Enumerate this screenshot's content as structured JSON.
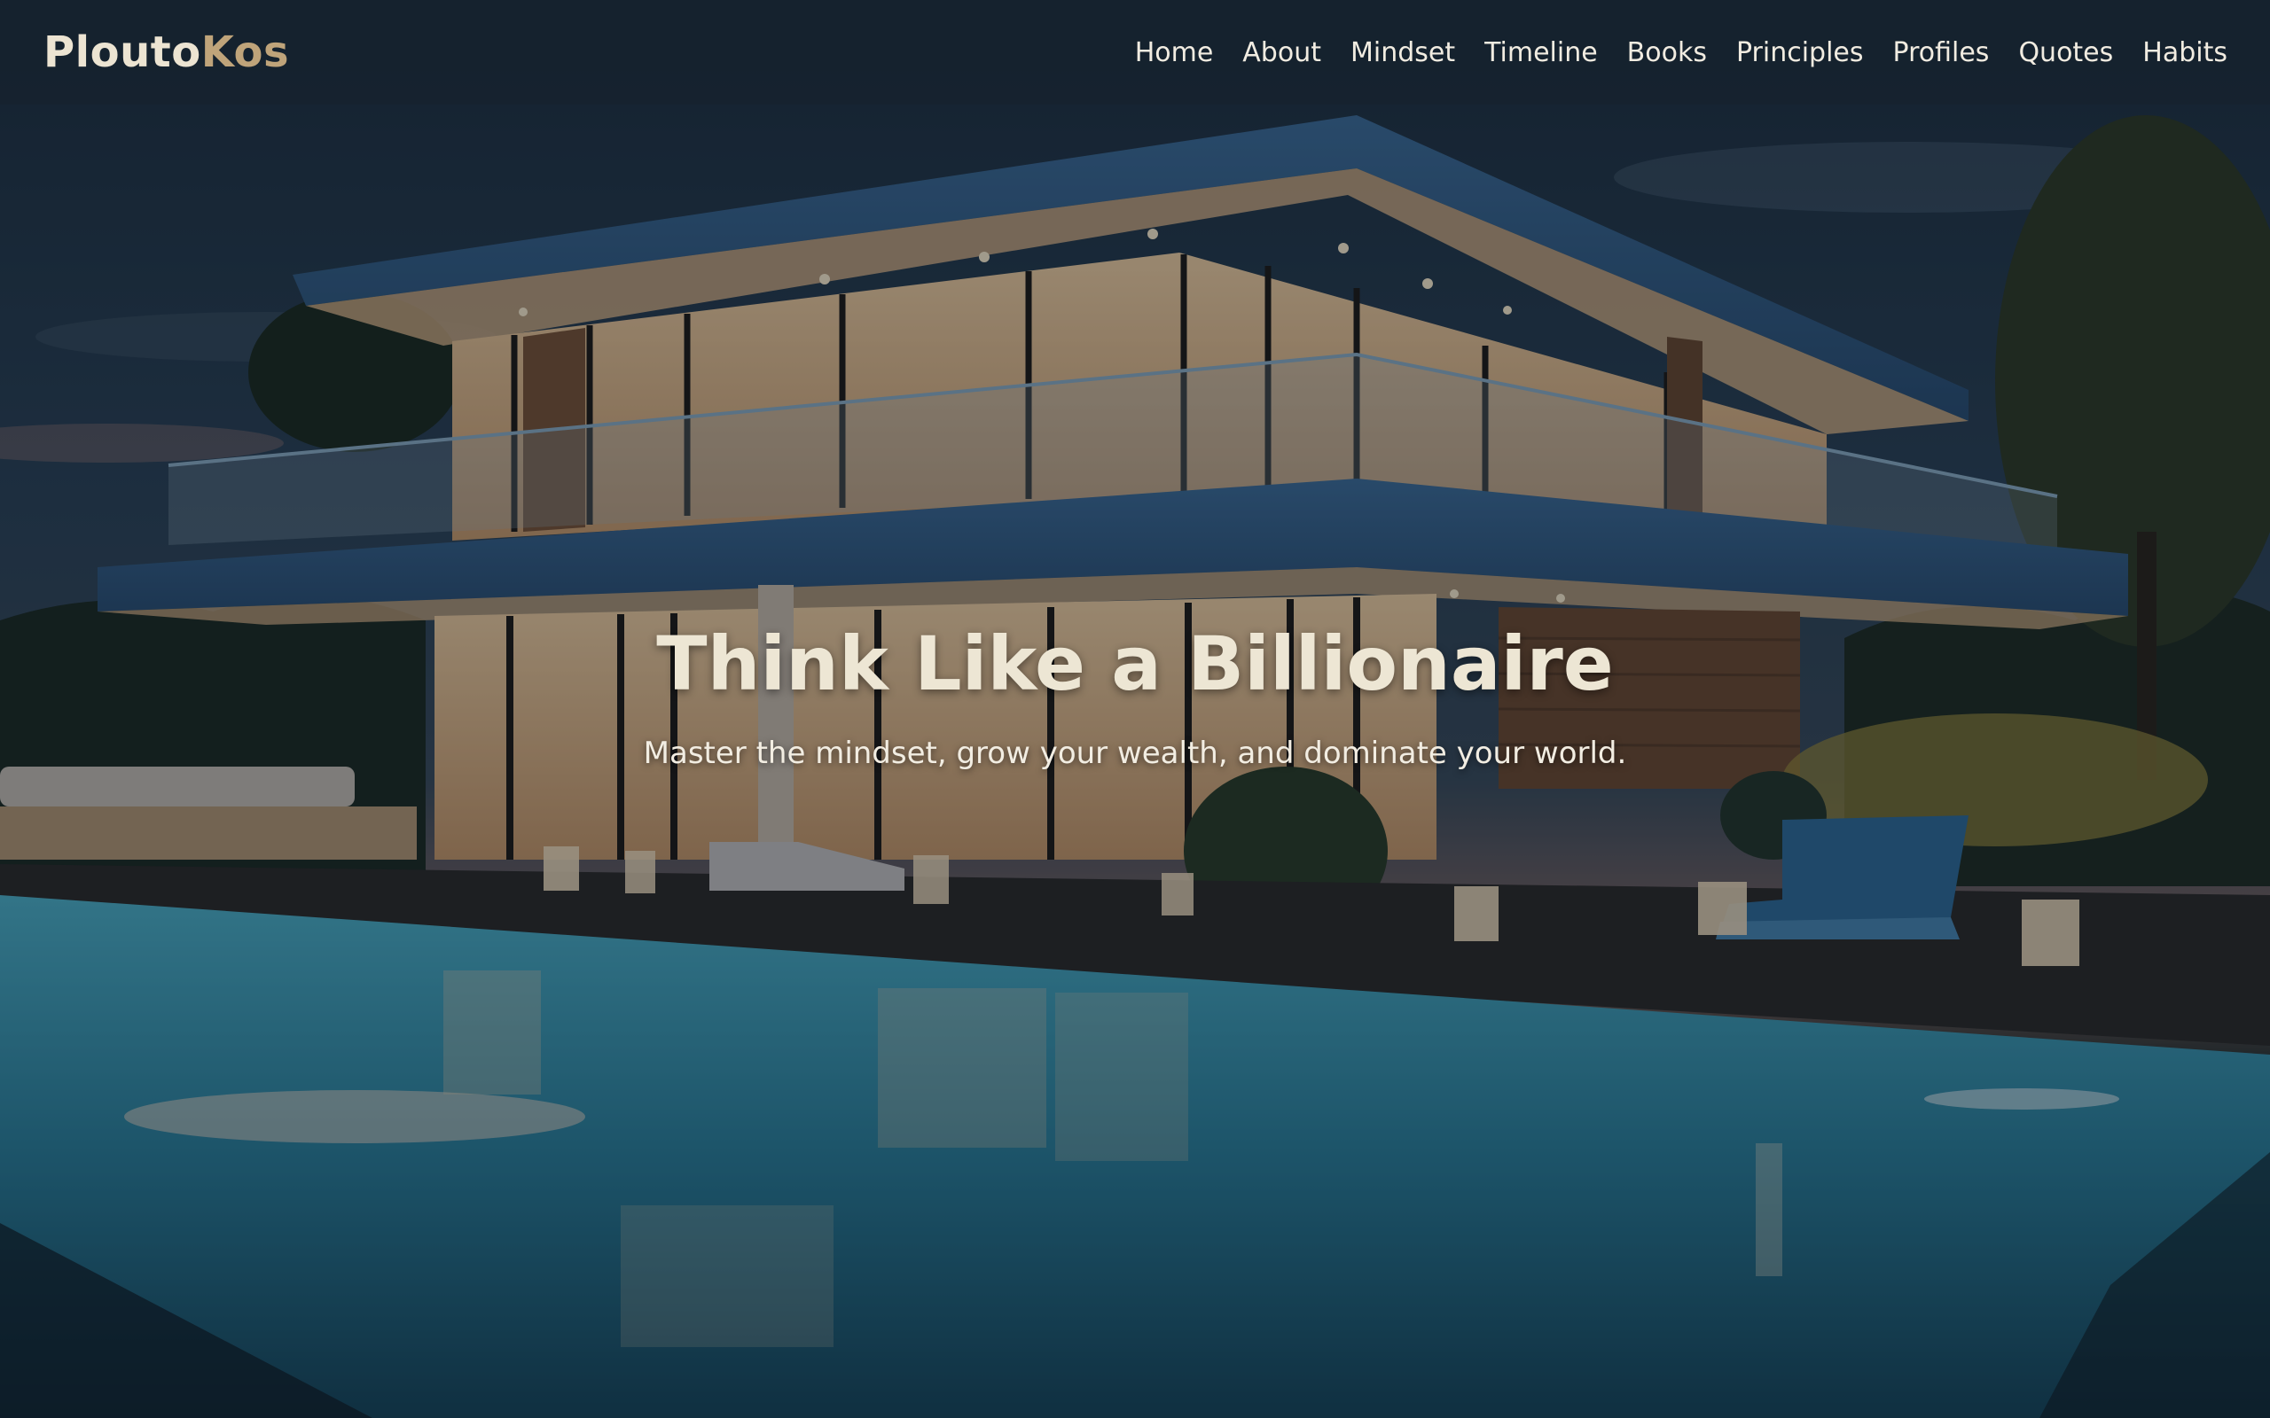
{
  "brand": {
    "name_part_1": "Plouto",
    "name_part_2": "Kos",
    "colors": {
      "primary_text": "#ece4d2",
      "accent_gold": "#bfa47a"
    }
  },
  "nav": {
    "items": [
      {
        "label": "Home"
      },
      {
        "label": "About"
      },
      {
        "label": "Mindset"
      },
      {
        "label": "Timeline"
      },
      {
        "label": "Books"
      },
      {
        "label": "Principles"
      },
      {
        "label": "Profiles"
      },
      {
        "label": "Quotes"
      },
      {
        "label": "Habits"
      }
    ]
  },
  "hero": {
    "title": "Think Like a Billionaire",
    "subtitle": "Master the mindset, grow your wealth, and dominate your world.",
    "background": "modern-villa-with-pool-at-dusk"
  }
}
